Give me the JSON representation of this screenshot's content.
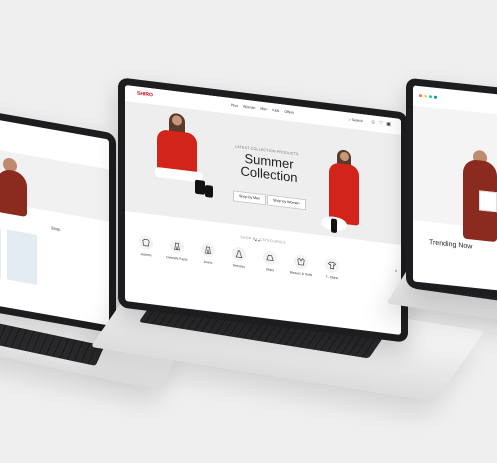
{
  "center": {
    "logo": "SHIRO",
    "menu": [
      "Plus",
      "Woman",
      "Men",
      "Kids",
      "Offers"
    ],
    "search_label": "Search",
    "icons": [
      "user-icon",
      "heart-icon",
      "cart-icon"
    ],
    "hero": {
      "eyebrow": "LATEST COLLECTION PRODUCTS",
      "headline": "Summer Collection",
      "buttons": [
        "Shop by Men",
        "Shop by Women"
      ]
    },
    "categories_title": "SHOP BY CATEGORIES",
    "categories": [
      {
        "label": "Jackets",
        "icon": "jacket-icon"
      },
      {
        "label": "Overalls Pants",
        "icon": "overalls-icon"
      },
      {
        "label": "Jeans",
        "icon": "jeans-icon"
      },
      {
        "label": "Dresses",
        "icon": "dress-icon"
      },
      {
        "label": "Skirts",
        "icon": "skirt-icon"
      },
      {
        "label": "Blazers & Suits",
        "icon": "blazer-icon"
      },
      {
        "label": "T- Shirts",
        "icon": "tshirt-icon"
      }
    ]
  },
  "left": {
    "hero_title": "ues",
    "link": "Shop"
  },
  "right": {
    "section_title": "Trending Now",
    "dot_colors": [
      "#ff6b6b",
      "#ffd166",
      "#06d6a0",
      "#118ab2"
    ]
  },
  "colors": {
    "accent": "#d0021b",
    "background": "#efefef"
  }
}
